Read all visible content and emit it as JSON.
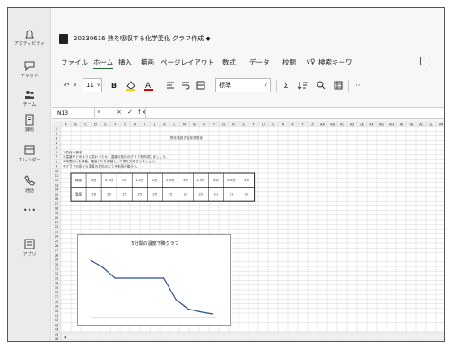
{
  "rail": {
    "items": [
      {
        "icon": "bell-icon",
        "label": "アクティビティ"
      },
      {
        "icon": "chat-icon",
        "label": "チャット"
      },
      {
        "icon": "teams-icon",
        "label": "チーム"
      },
      {
        "icon": "assignments-icon",
        "label": "課題"
      },
      {
        "icon": "calendar-icon",
        "label": "カレンダー"
      },
      {
        "icon": "phone-icon",
        "label": "通話"
      },
      {
        "icon": "more-icon",
        "label": "•••"
      },
      {
        "icon": "apps-icon",
        "label": "アプリ"
      }
    ]
  },
  "window": {
    "title": "20230616 熱を吸収する化学変化 グラフ作成"
  },
  "menu": {
    "items": [
      "ファイル",
      "ホーム",
      "挿入",
      "描画",
      "ページレイアウト",
      "数式",
      "データ",
      "校閲",
      "∨",
      "検索キーワ"
    ],
    "active": "ホーム"
  },
  "toolbar": {
    "undo": "↶",
    "font_size": "11",
    "bold": "B",
    "number_format": "標準",
    "sum": "Σ",
    "more": "···"
  },
  "formula": {
    "cell_ref": "N13",
    "icons": "× ✓ fx"
  },
  "sheet": {
    "sheet_title": "熱を吸収する化学変化",
    "notes": [
      "1.変化の様子",
      "2.温度がどのように変わったか、温度の変化のグラフを作成しましょう。",
      "3.時間(分)を横軸、温度(℃)を縦軸として表を完成させましょう。",
      "4.グラフの形から温度の変化のようすを読み取ろう。"
    ],
    "table_header": [
      "時間",
      "0分",
      "0.5分",
      "1分",
      "1.5分",
      "2分",
      "2.5分",
      "3分",
      "3.5分",
      "4分",
      "4.5分",
      "5分"
    ],
    "table_values": [
      "温度",
      "26",
      "25",
      "25",
      "25",
      "25",
      "25",
      "23",
      "22",
      "21",
      "21",
      "20"
    ]
  },
  "chart_data": {
    "type": "line",
    "title": "5分間の温度下降グラフ",
    "xlabel": "",
    "ylabel": "",
    "x": [
      0,
      0.5,
      1,
      1.5,
      2,
      2.5,
      3,
      3.5,
      4,
      4.5,
      5
    ],
    "values": [
      26,
      25,
      23.5,
      23.5,
      23.5,
      23.5,
      23.5,
      20.5,
      19.2,
      18.8,
      18.5
    ],
    "ylim": [
      18,
      27
    ],
    "grid": false,
    "color": "#2f4f8f"
  }
}
